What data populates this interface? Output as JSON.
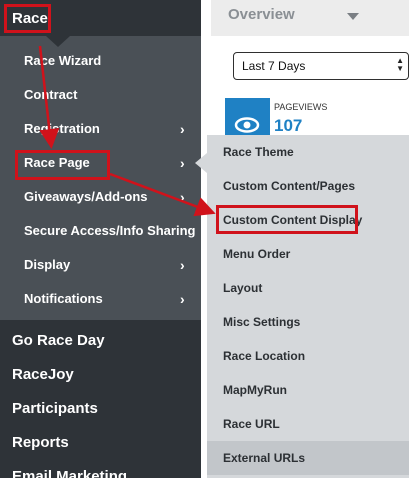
{
  "sidebar": {
    "race_header": "Race",
    "sub_items": [
      {
        "label": "Race Wizard",
        "has_chevron": false
      },
      {
        "label": "Contract",
        "has_chevron": false
      },
      {
        "label": "Registration",
        "has_chevron": true
      },
      {
        "label": "Race Page",
        "has_chevron": true
      },
      {
        "label": "Giveaways/Add-ons",
        "has_chevron": true
      },
      {
        "label": "Secure Access/Info Sharing",
        "has_chevron": false
      },
      {
        "label": "Display",
        "has_chevron": true
      },
      {
        "label": "Notifications",
        "has_chevron": true
      }
    ],
    "chevron": "›",
    "main_items": [
      "Go Race Day",
      "RaceJoy",
      "Participants",
      "Reports",
      "Email Marketing"
    ]
  },
  "content": {
    "overview_title": "Overview",
    "range_select": {
      "value": "Last 7 Days",
      "updown": "▲▼"
    },
    "pageviews": {
      "label": "PAGEVIEWS",
      "value": "107",
      "icon": "eye-icon"
    }
  },
  "popup_menu": {
    "items": [
      "Race Theme",
      "Custom Content/Pages",
      "Custom Content Display",
      "Menu Order",
      "Layout",
      "Misc Settings",
      "Race Location",
      "MapMyRun",
      "Race URL",
      "External URLs"
    ],
    "highlighted": "Custom Content Display",
    "hovered": "External URLs"
  },
  "colors": {
    "sidebar_dark": "#2e3338",
    "sidebar_sub": "#4a5056",
    "annotation_red": "#d0121b",
    "accent_blue": "#1f81c4",
    "popup_bg": "#d5d8db"
  }
}
